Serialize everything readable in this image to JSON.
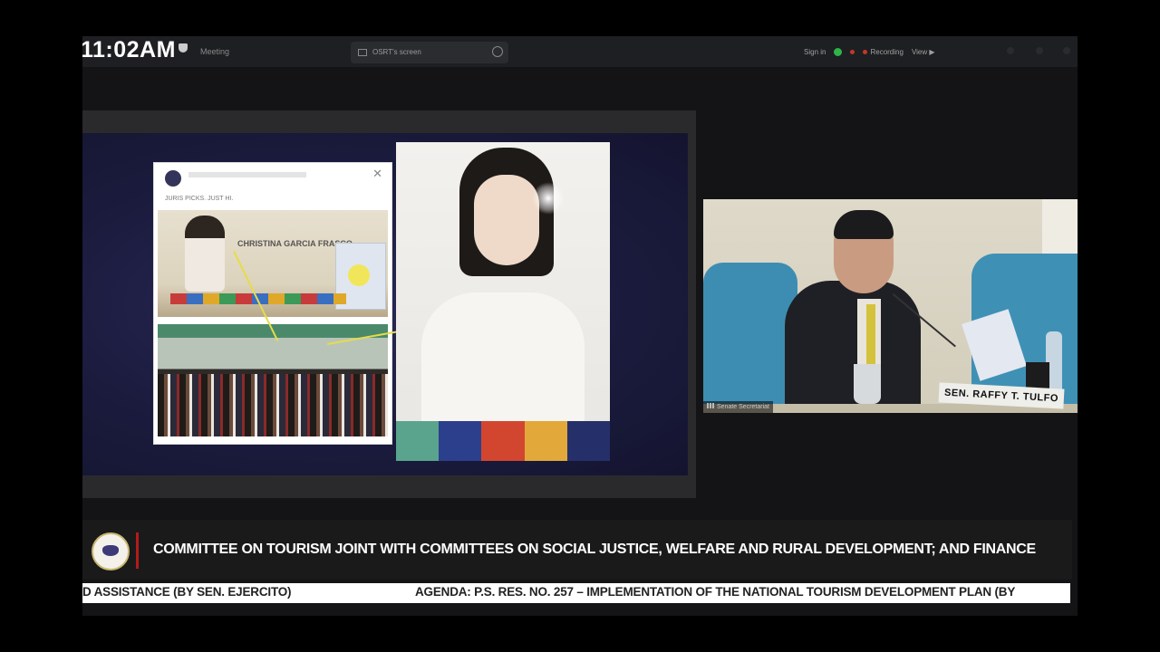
{
  "topbar": {
    "time": "11:02AM",
    "meeting_label": "Meeting",
    "share_tab_label": "OSRT's screen",
    "sign_in_label": "Sign in",
    "recording_label": "Recording",
    "view_label": "View"
  },
  "screen_share": {
    "post_caption": "JURIS PICKS. JUST HI.",
    "banner_text": "CHRISTINA GARCIA FRASCO"
  },
  "video_tile": {
    "participant_label": "Senate Secretariat",
    "nameplate": "SEN. RAFFY T. TULFO"
  },
  "lower_third": {
    "committee_title": "COMMITTEE ON TOURISM JOINT WITH COMMITTEES ON SOCIAL JUSTICE, WELFARE AND RURAL DEVELOPMENT; AND FINANCE"
  },
  "ticker": {
    "left_text": "D ASSISTANCE (BY SEN. EJERCITO)",
    "agenda_text": "AGENDA:  P.S. RES. NO. 257 – IMPLEMENTATION OF THE NATIONAL TOURISM DEVELOPMENT PLAN (BY"
  },
  "colors": {
    "slide_bg": "#1b1b3e",
    "arrow": "#e6dc4a",
    "recording_dot": "#c0392b",
    "secure_dot": "#2fb34a",
    "accent_bar": "#b31b1b",
    "chair": "#3d8db2"
  }
}
